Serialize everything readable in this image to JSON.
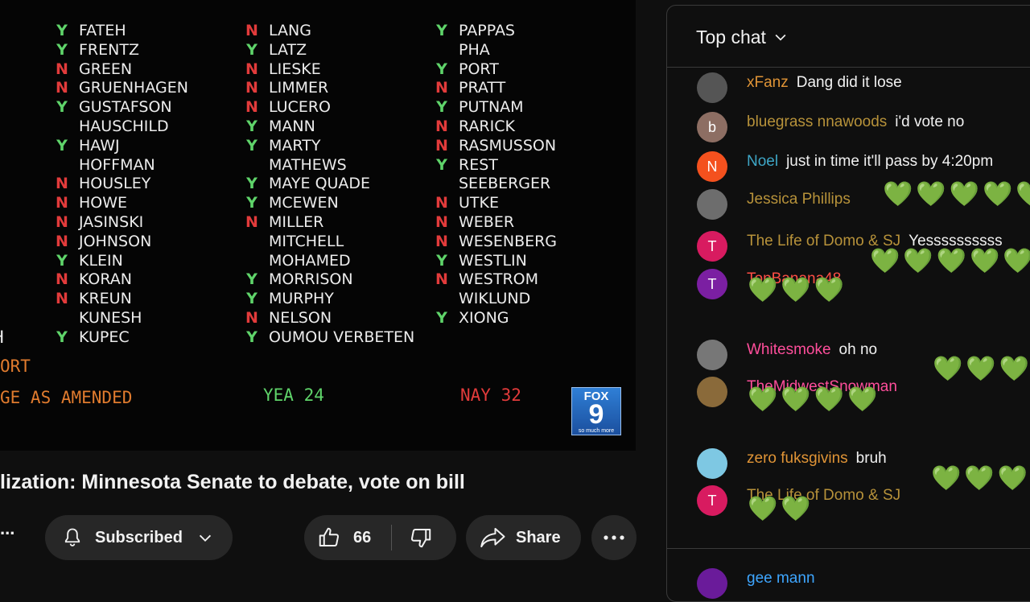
{
  "video": {
    "col1": [
      {
        "m": "Y",
        "n": "FATEH"
      },
      {
        "m": "Y",
        "n": "FRENTZ"
      },
      {
        "m": "N",
        "n": "GREEN"
      },
      {
        "m": "N",
        "n": "GRUENHAGEN"
      },
      {
        "m": "Y",
        "n": "GUSTAFSON"
      },
      {
        "m": "",
        "n": "HAUSCHILD"
      },
      {
        "m": "Y",
        "n": "HAWJ"
      },
      {
        "m": "",
        "n": "HOFFMAN"
      },
      {
        "m": "N",
        "n": "HOUSLEY"
      },
      {
        "m": "N",
        "n": "HOWE"
      },
      {
        "m": "N",
        "n": "JASINSKI"
      },
      {
        "m": "N",
        "n": "JOHNSON"
      },
      {
        "m": "Y",
        "n": "KLEIN"
      },
      {
        "m": "N",
        "n": "KORAN"
      },
      {
        "m": "N",
        "n": "KREUN"
      },
      {
        "m": "",
        "n": "KUNESH"
      },
      {
        "m": "Y",
        "n": "KUPEC"
      }
    ],
    "col2": [
      {
        "m": "N",
        "n": "LANG"
      },
      {
        "m": "Y",
        "n": "LATZ"
      },
      {
        "m": "N",
        "n": "LIESKE"
      },
      {
        "m": "N",
        "n": "LIMMER"
      },
      {
        "m": "N",
        "n": "LUCERO"
      },
      {
        "m": "Y",
        "n": "MANN"
      },
      {
        "m": "Y",
        "n": "MARTY"
      },
      {
        "m": "",
        "n": "MATHEWS"
      },
      {
        "m": "Y",
        "n": "MAYE QUADE"
      },
      {
        "m": "Y",
        "n": "MCEWEN"
      },
      {
        "m": "N",
        "n": "MILLER"
      },
      {
        "m": "",
        "n": "MITCHELL"
      },
      {
        "m": "",
        "n": "MOHAMED"
      },
      {
        "m": "Y",
        "n": "MORRISON"
      },
      {
        "m": "Y",
        "n": "MURPHY"
      },
      {
        "m": "N",
        "n": "NELSON"
      },
      {
        "m": "Y",
        "n": "OUMOU VERBETEN"
      }
    ],
    "col3": [
      {
        "m": "Y",
        "n": "PAPPAS"
      },
      {
        "m": "",
        "n": "PHA"
      },
      {
        "m": "Y",
        "n": "PORT"
      },
      {
        "m": "N",
        "n": "PRATT"
      },
      {
        "m": "Y",
        "n": "PUTNAM"
      },
      {
        "m": "N",
        "n": "RARICK"
      },
      {
        "m": "N",
        "n": "RASMUSSON"
      },
      {
        "m": "Y",
        "n": "REST"
      },
      {
        "m": "",
        "n": "SEEBERGER"
      },
      {
        "m": "N",
        "n": "UTKE"
      },
      {
        "m": "N",
        "n": "WEBER"
      },
      {
        "m": "N",
        "n": "WESENBERG"
      },
      {
        "m": "Y",
        "n": "WESTLIN"
      },
      {
        "m": "N",
        "n": "WESTROM"
      },
      {
        "m": "",
        "n": "WIKLUND"
      },
      {
        "m": "Y",
        "n": "XIONG"
      }
    ],
    "edge_h": "H",
    "report_label": "ORT",
    "passage_label": "GE AS AMENDED",
    "yea_label": "YEA 24",
    "nay_label": "NAY 32",
    "logo": {
      "fox": "FOX",
      "num": "9",
      "tag": "so much more"
    },
    "colors": {
      "yes": "#5fd46a",
      "no": "#e23b3b",
      "orange": "#e07b2e",
      "green": "#5fd46a",
      "red": "#e23b3b"
    }
  },
  "title": "lization: Minnesota Senate to debate, vote on bill",
  "actions": {
    "ellipsis": "...",
    "subscribed": "Subscribed",
    "like_count": "66",
    "share": "Share"
  },
  "chat": {
    "header": "Top chat",
    "messages": [
      {
        "author": "xFanz",
        "color": "#e09436",
        "text": "Dang did it lose",
        "avatar": "",
        "avatar_color": "#555"
      },
      {
        "author": "bluegrass nnawoods",
        "color": "#b7923a",
        "text": "i'd vote no",
        "avatar": "b",
        "avatar_color": "#8d6e63"
      },
      {
        "author": "Noel",
        "color": "#3ea6c6",
        "text": "just in time it'll pass by 4:20pm",
        "avatar": "N",
        "avatar_color": "#f4511e"
      },
      {
        "author": "Jessica Phillips",
        "color": "#b7923a",
        "text": "",
        "avatar": "",
        "avatar_color": "#6d6d6d"
      },
      {
        "author": "The Life of Domo & SJ",
        "color": "#b7923a",
        "text": "Yessssssssss",
        "avatar": "T",
        "avatar_color": "#d81b60"
      },
      {
        "author": "TopBanana48",
        "color": "#ff4e45",
        "text": "",
        "avatar": "T",
        "avatar_color": "#7b1fa2"
      },
      {
        "author": "Whitesmoke",
        "color": "#ff4e9b",
        "text": "oh no",
        "avatar": "",
        "avatar_color": "#777"
      },
      {
        "author": "TheMidwestSnowman",
        "color": "#ff4e9b",
        "text": "",
        "avatar": "",
        "avatar_color": "#8a6a3a"
      },
      {
        "author": "zero fuksgivins",
        "color": "#e09436",
        "text": "bruh",
        "avatar": "",
        "avatar_color": "#7ec8e3"
      },
      {
        "author": "The Life of Domo & SJ",
        "color": "#b7923a",
        "text": "",
        "avatar": "T",
        "avatar_color": "#d81b60"
      },
      {
        "author": "gee mann",
        "color": "#3ea6ff",
        "text": "",
        "avatar": "",
        "avatar_color": "#6a1b9a"
      }
    ],
    "hearts": {
      "jessica": "💚💚💚💚💚",
      "topbanana_1": "💚💚💚💚💚",
      "topbanana_2": "💚💚💚",
      "midwest_1": "💚💚💚💚",
      "midwest_2": "💚💚💚💚",
      "domo_1": "💚💚💚💚",
      "domo_2": "💚💚"
    }
  }
}
